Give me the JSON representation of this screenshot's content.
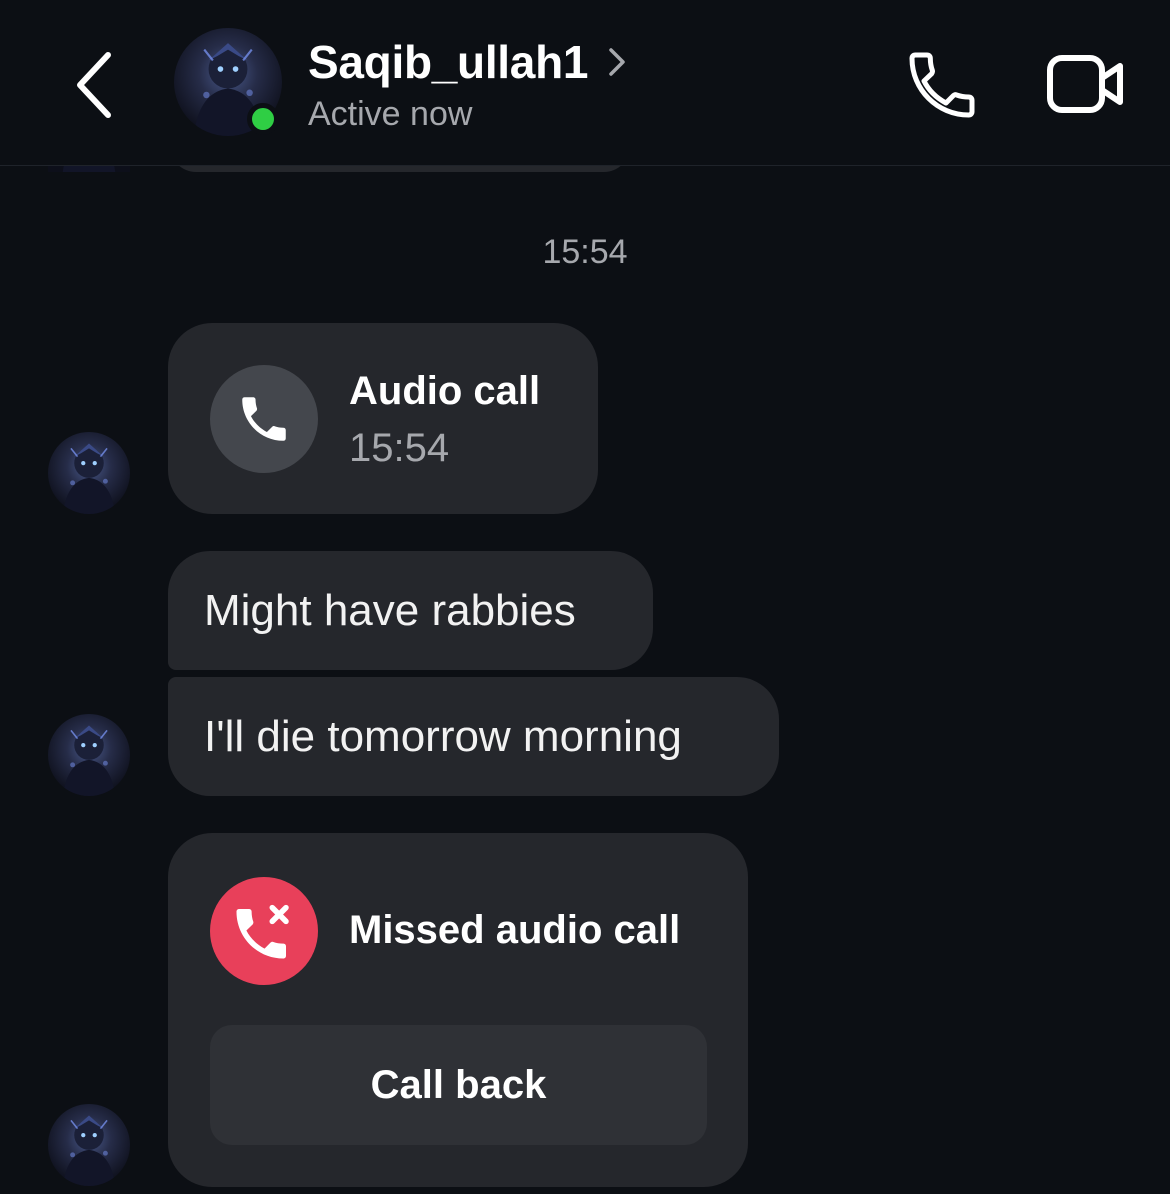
{
  "header": {
    "username": "Saqib_ullah1",
    "status": "Active now",
    "status_color": "#2fce44",
    "icons": [
      "back-chevron-icon",
      "chevron-right-icon",
      "phone-icon",
      "video-camera-icon"
    ]
  },
  "thread": {
    "timestamp": "15:54",
    "audio_call": {
      "title": "Audio call",
      "time": "15:54",
      "icon": "phone-icon"
    },
    "messages": [
      {
        "text": "Might have rabbies"
      },
      {
        "text": "I'll die tomorrow morning"
      }
    ],
    "missed_call": {
      "title": "Missed audio call",
      "button_label": "Call back",
      "icon": "missed-call-icon",
      "icon_color": "#e8405a"
    }
  },
  "colors": {
    "background": "#0c0f14",
    "bubble": "#25272c",
    "secondary_text": "#a6a8ad"
  }
}
